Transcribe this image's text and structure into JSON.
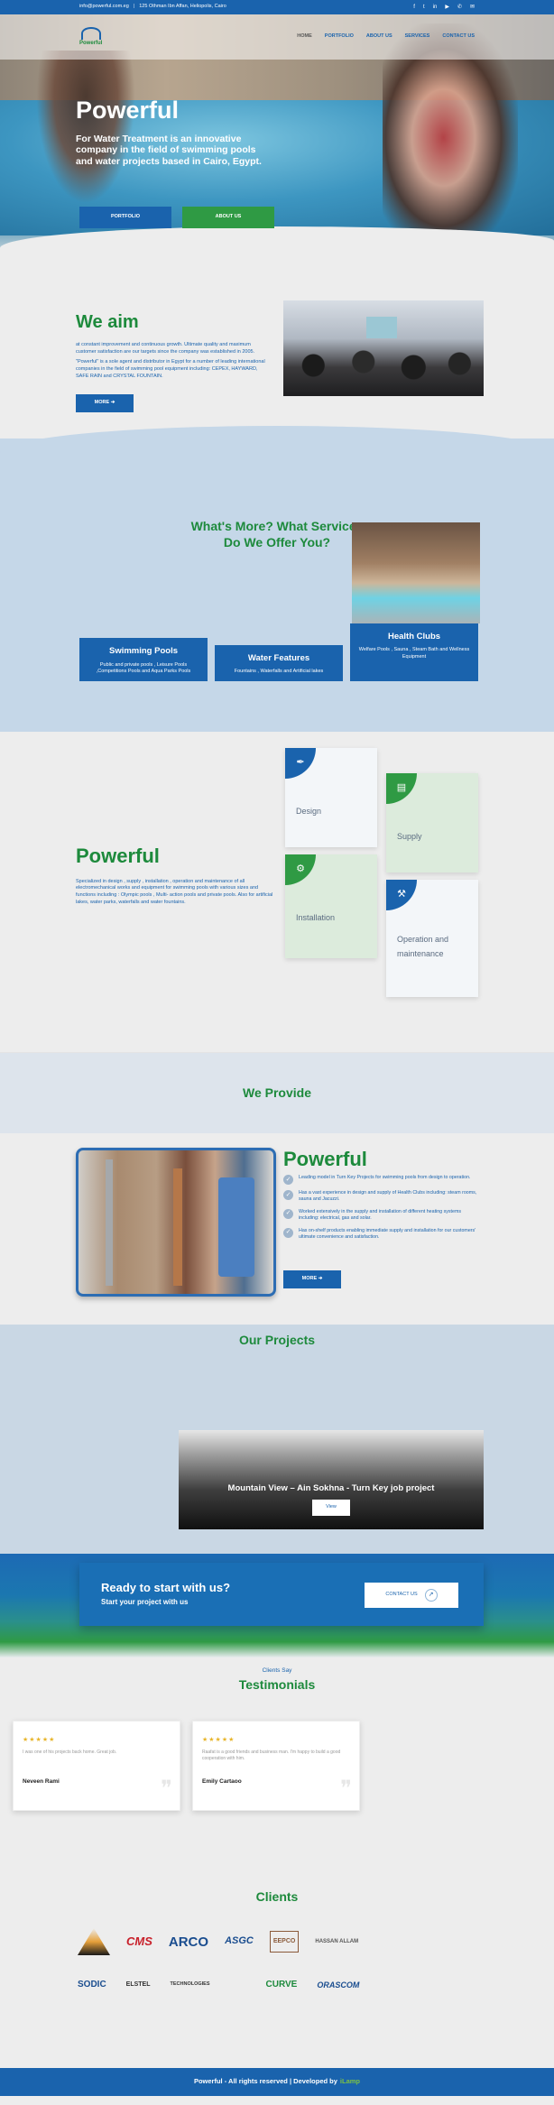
{
  "topbar": {
    "email": "info@powerful.com.eg",
    "address": "125 Othman Ibn Affan, Heliopolis, Cairo",
    "social": [
      "f",
      "t",
      "in",
      "▶",
      "✆",
      "✉"
    ]
  },
  "nav": {
    "logo_text": "Powerful",
    "items": [
      "HOME",
      "PORTFOLIO",
      "ABOUT US",
      "SERVICES",
      "CONTACT US"
    ]
  },
  "hero": {
    "title": "Powerful",
    "text": "For Water Treatment is an innovative company in the field of swimming pools and water projects based in Cairo, Egypt.",
    "btn_portfolio": "PORTFOLIO",
    "btn_about": "ABOUT US"
  },
  "aim": {
    "title": "We aim",
    "p1": "at constant improvement and continuous growth. Ultimate quality and maximum customer satisfaction are our targets since the company was established in 2005.",
    "p2": "\"Powerful\" is a sole agent and distributor in Egypt for a number of leading international companies in the field of swimming pool equipment including: CEPEX, HAYWARD, SAFE RAIN and CRYSTAL FOUNTAIN.",
    "more": "MORE ➔"
  },
  "services": {
    "title_line1": "What's More? What Services",
    "title_line2": "Do We Offer You?",
    "cards": [
      {
        "title": "Swimming Pools",
        "text": "Public and private pools , Leisure Pools ,Competitions Pools and Aqua Parks Pools"
      },
      {
        "title": "Water Features",
        "text": "Fountains , Waterfalls and Artificial lakes"
      },
      {
        "title": "Health Clubs",
        "text": "Welfare Pools , Sauna , Steam Bath and Wellness Equipment"
      }
    ]
  },
  "powerful_about": {
    "title": "Powerful",
    "text": "Specialized in design , supply , installation , operation and maintenance of all electromechanical works and equipment for swimming pools with various sizes and functions including : Olympic pools , Multi- action pools and private pools. Also for artificial lakes, water parks, waterfalls and water fountains.",
    "tiles": [
      {
        "label": "Design",
        "icon": "design-icon",
        "glyph": "✒"
      },
      {
        "label": "Supply",
        "icon": "supply-icon",
        "glyph": "▤"
      },
      {
        "label": "Installation",
        "icon": "gear-icon",
        "glyph": "⚙"
      },
      {
        "label": "Operation and maintenance",
        "icon": "tools-icon",
        "glyph": "⚒"
      }
    ]
  },
  "provide": {
    "title": "We Provide"
  },
  "powerful_provide": {
    "title": "Powerful",
    "items": [
      "Leading model in Turn Key Projects for swimming pools from design to operation.",
      "Has a vast experience in design and supply of Health Clubs including: steam rooms, sauna and Jacuzzi.",
      "Worked extensively in the supply and installation of different heating systems including: electrical, gas and solar.",
      "Has on-shelf products enabling immediate supply and installation for our customers' ultimate convenience and satisfaction."
    ],
    "more": "MORE ➔"
  },
  "projects": {
    "title": "Our Projects",
    "card_title": "Mountain View – Ain Sokhna - Turn Key job project",
    "view": "View"
  },
  "cta": {
    "title": "Ready to start with us?",
    "subtitle": "Start your project with us",
    "button": "CONTACT US"
  },
  "testimonials": {
    "sub": "Clients Say",
    "title": "Testimonials",
    "items": [
      {
        "stars": "★★★★★",
        "quote": "I was one of his projects back home. Great job.",
        "author": "Neveen Rami"
      },
      {
        "stars": "★★★★★",
        "quote": "Raafat is a good friends and business man. I'm happy to build a good cooperation with him.",
        "author": "Emily Cartaoo"
      }
    ]
  },
  "clients": {
    "title": "Clients",
    "row1": [
      "CMS",
      "ARCO",
      "ASGC",
      "EEPCO",
      "HASSAN ALLAM"
    ],
    "row2": [
      "SODIC",
      "ELSTEL",
      "TECHNOLOGIES",
      "CURVE",
      "ORASCOM"
    ]
  },
  "footer": {
    "text": "Powerful - All rights reserved | Developed by",
    "dev": "iLamp"
  },
  "colors": {
    "brand_blue": "#1a63ad",
    "brand_green": "#1d8a3c"
  }
}
